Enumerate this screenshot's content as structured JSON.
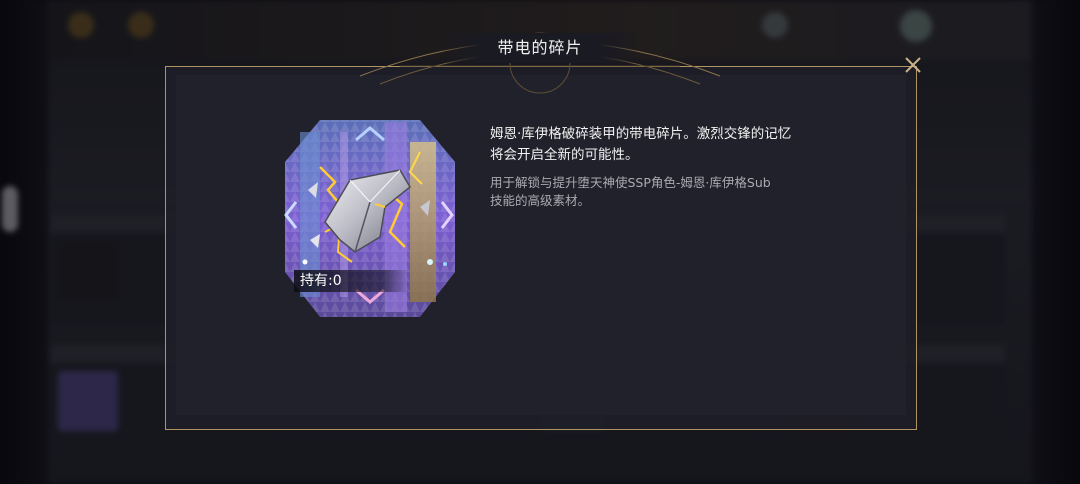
{
  "dialog": {
    "title": "带电的碎片",
    "close_icon": "close-x-icon"
  },
  "item": {
    "count_label": "持有:",
    "count_value": "0",
    "art_icon": "charged-armor-fragment-icon"
  },
  "description": {
    "main": "姆恩·库伊格破碎装甲的带电碎片。激烈交锋的记忆将会开启全新的可能性。",
    "usage": "用于解锁与提升堕天神使SSP角色-姆恩·库伊格Sub技能的高级素材。"
  },
  "colors": {
    "border_gold": "#b29462",
    "title_text": "#f1f1f1",
    "desc_main": "#f2f2f2",
    "desc_sub": "#a9aab2",
    "item_bg_purple": "#7b5fd0"
  }
}
